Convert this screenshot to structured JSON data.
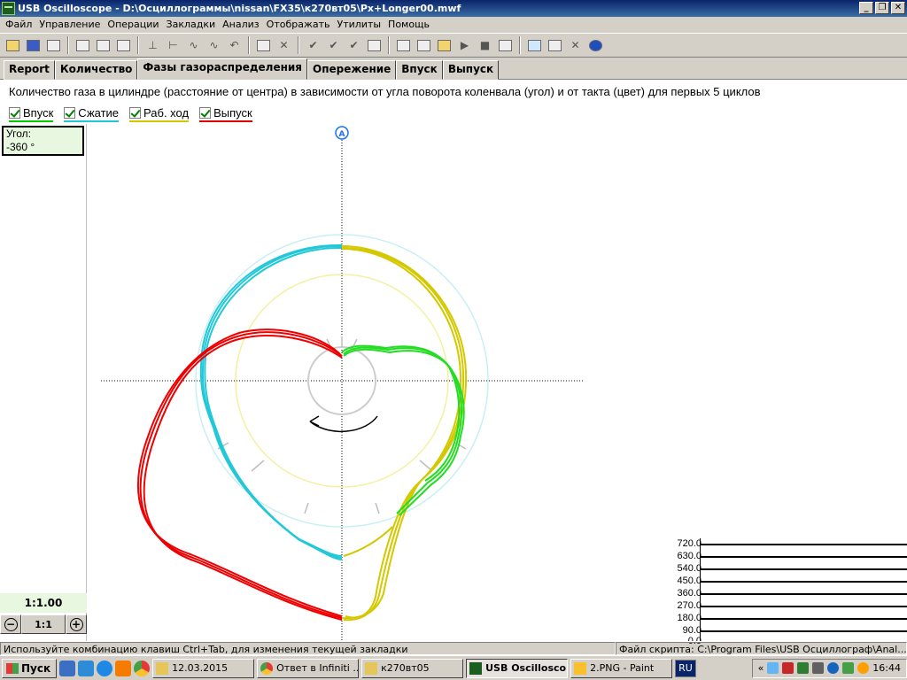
{
  "window": {
    "title": "USB Oscilloscope - D:\\Осциллограммы\\nissan\\FX35\\к270вт05\\Px+Longer00.mwf",
    "buttons": {
      "minimize": "_",
      "restore": "❐",
      "close": "✕"
    }
  },
  "menu": [
    "Файл",
    "Управление",
    "Операции",
    "Закладки",
    "Анализ",
    "Отображать",
    "Утилиты",
    "Помощь"
  ],
  "tabs": [
    {
      "label": "Report",
      "active": false
    },
    {
      "label": "Количество",
      "active": false
    },
    {
      "label": "Фазы газораспределения",
      "active": true
    },
    {
      "label": "Опережение",
      "active": false
    },
    {
      "label": "Впуск",
      "active": false
    },
    {
      "label": "Выпуск",
      "active": false
    }
  ],
  "description": "Количество газа в цилиндре (расстояние от центра) в зависимости от угла поворота коленвала (угол) и от такта (цвет) для первых 5 циклов",
  "legend": [
    {
      "label": "Впуск",
      "color": "#00cc00",
      "checked": true
    },
    {
      "label": "Сжатие",
      "color": "#22c8d8",
      "checked": true
    },
    {
      "label": "Раб. ход",
      "color": "#d4c800",
      "checked": true
    },
    {
      "label": "Выпуск",
      "color": "#e00000",
      "checked": true
    }
  ],
  "angle_box": {
    "label": "Угол:",
    "value": "-360 °"
  },
  "zoom": {
    "ratio": "1:1.00",
    "button_minus": "−",
    "button_reset": "1:1",
    "button_plus": "+"
  },
  "marker": {
    "label": "A"
  },
  "scale": {
    "values": [
      "720.0",
      "630.0",
      "540.0",
      "450.0",
      "360.0",
      "270.0",
      "180.0",
      "90.0",
      "0.0"
    ]
  },
  "status": {
    "hint": "Используйте комбинацию клавиш Ctrl+Tab, для изменения текущей закладки",
    "script": "Файл скрипта: C:\\Program Files\\USB Осциллограф\\Anal...\\Px.asc"
  },
  "taskbar": {
    "start": "Пуск",
    "tasks": [
      {
        "label": "12.03.2015",
        "active": false
      },
      {
        "label": "Ответ в Infiniti ...",
        "active": false
      },
      {
        "label": "к270вт05",
        "active": false
      },
      {
        "label": "USB Oscillosco...",
        "active": true
      },
      {
        "label": "2.PNG - Paint",
        "active": false
      }
    ],
    "lang": "RU",
    "clock": "16:44"
  }
}
